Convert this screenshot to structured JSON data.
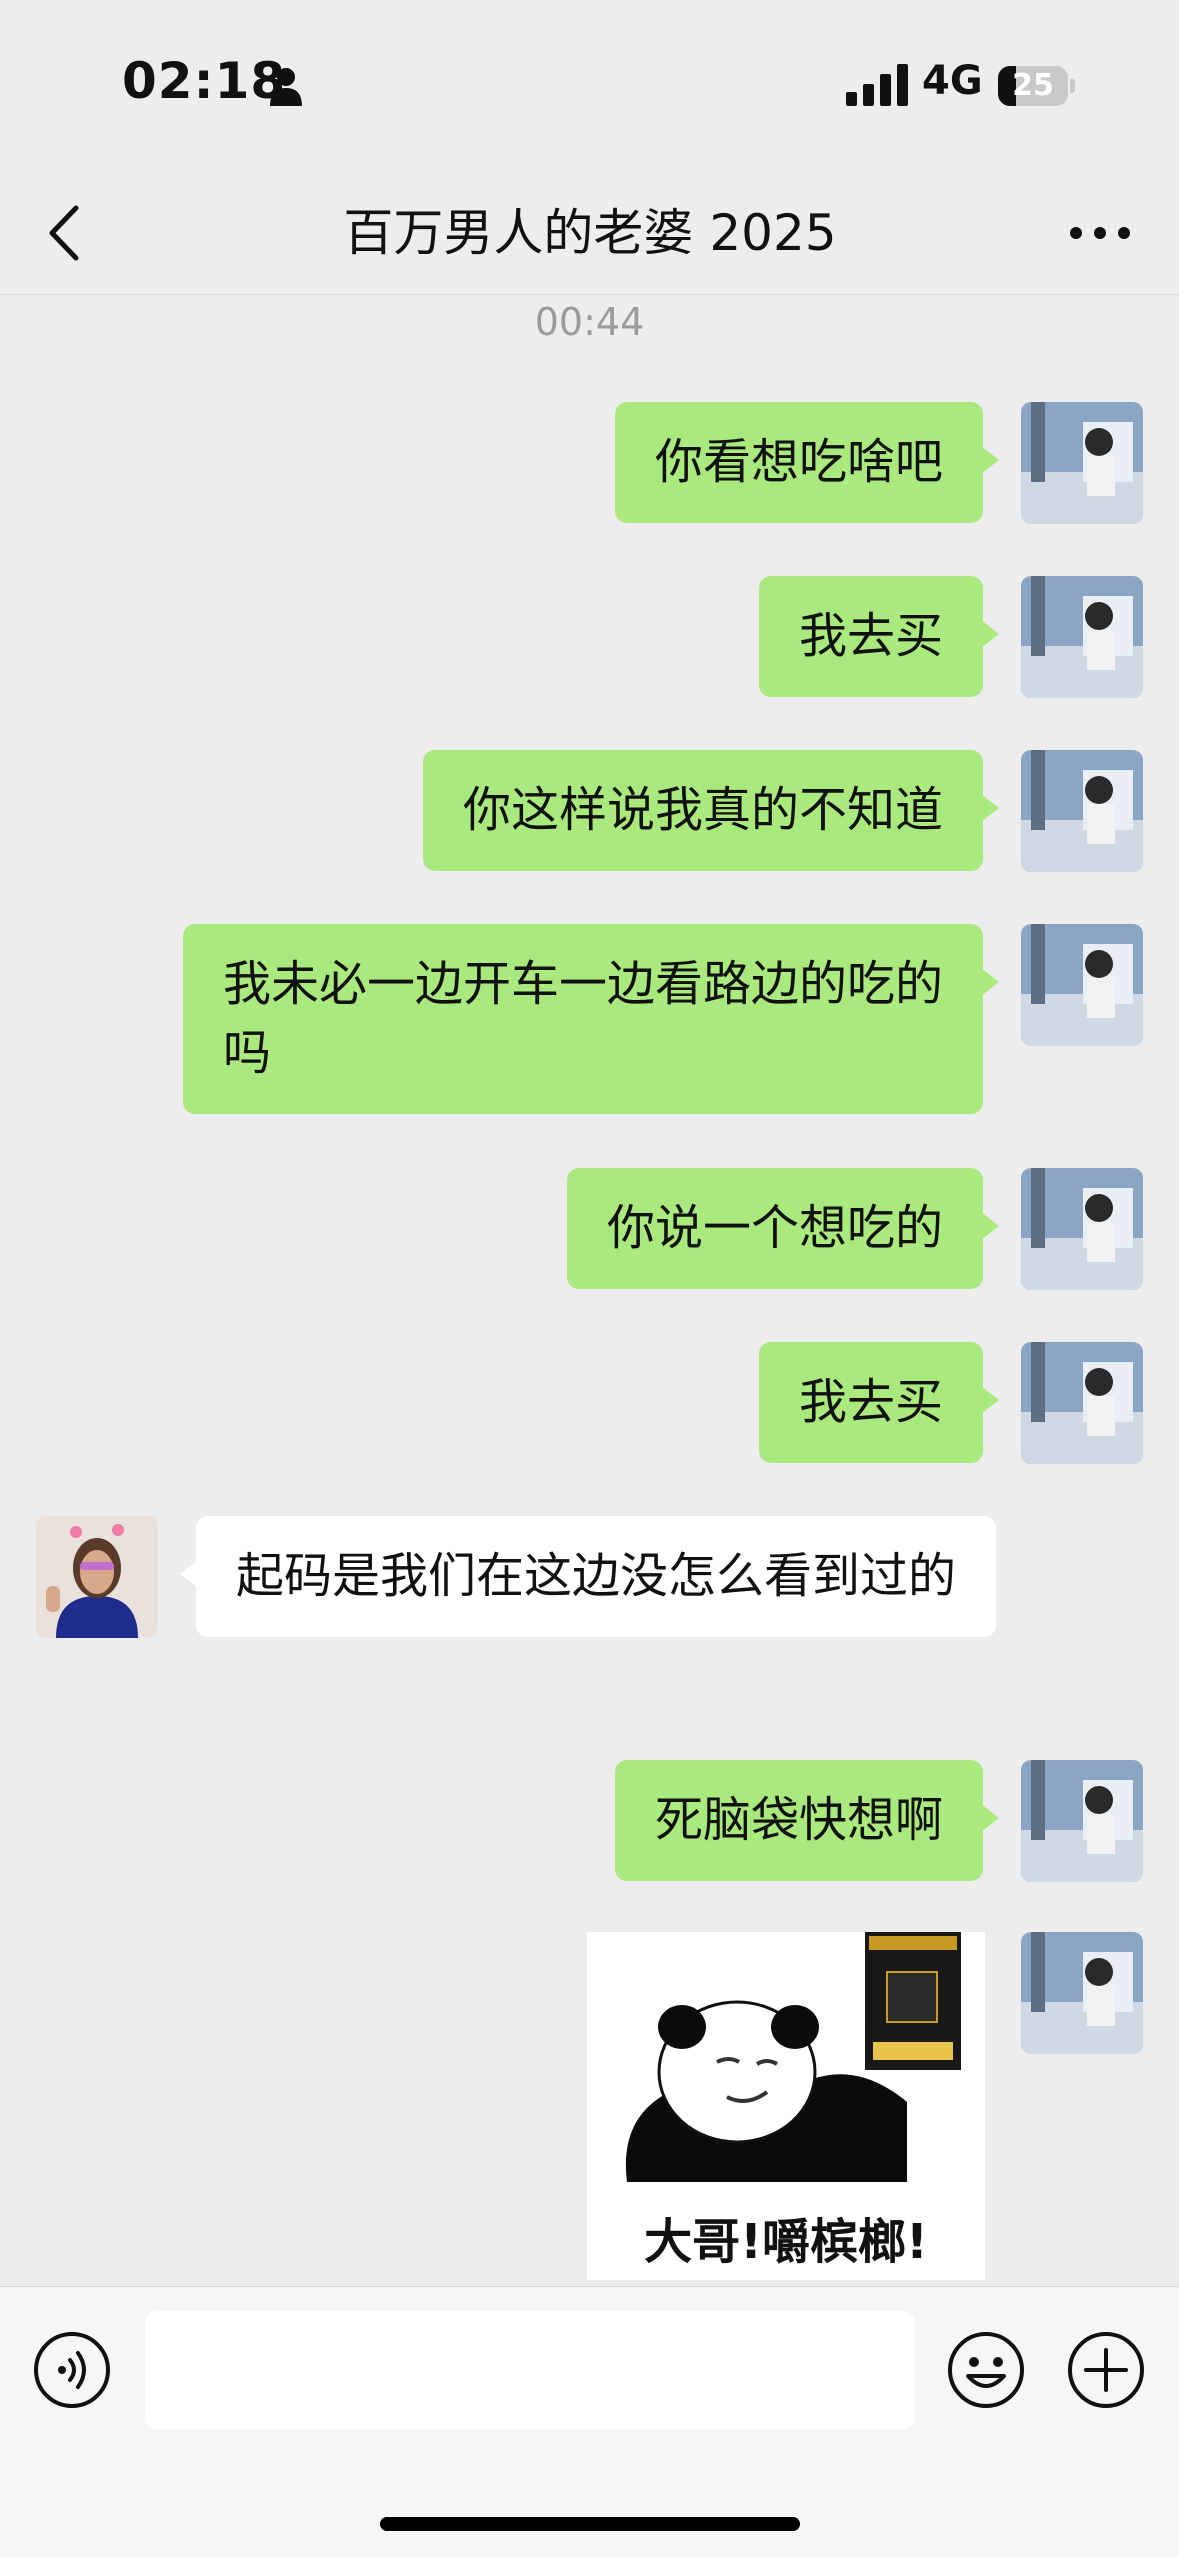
{
  "status_bar": {
    "time": "02:18",
    "network": "4G",
    "battery": "25",
    "battery_level": 0.25
  },
  "nav": {
    "title": "百万男人的老婆 2025"
  },
  "chat": {
    "timestamp": "00:44",
    "messages": [
      {
        "side": "out",
        "text": "你看想吃啥吧"
      },
      {
        "side": "out",
        "text": "我去买"
      },
      {
        "side": "out",
        "text": "你这样说我真的不知道"
      },
      {
        "side": "out",
        "text": "我未必一边开车一边看路边的吃的吗"
      },
      {
        "side": "out",
        "text": "你说一个想吃的"
      },
      {
        "side": "out",
        "text": "我去买"
      },
      {
        "side": "in",
        "text": "起码是我们在这边没怎么看到过的"
      },
      {
        "side": "out",
        "text": "死脑袋快想啊"
      }
    ],
    "sticker": {
      "caption": "大哥!嚼槟榔!"
    }
  },
  "input": {
    "value": "",
    "placeholder": ""
  },
  "colors": {
    "out_bubble": "#a9e97e",
    "in_bubble": "#ffffff",
    "background": "#ededed"
  },
  "icons": [
    "person-icon",
    "signal-icon",
    "battery-icon",
    "back-arrow-icon",
    "more-icon",
    "voice-icon",
    "emoji-icon",
    "plus-icon"
  ]
}
